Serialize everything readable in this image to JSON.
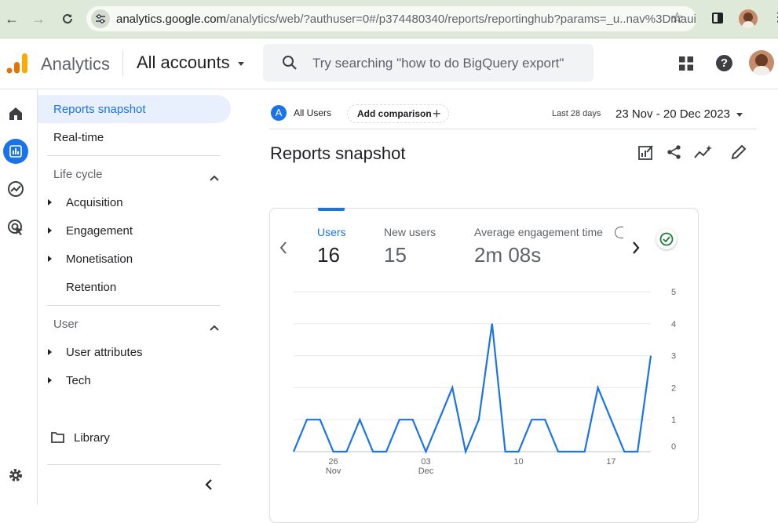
{
  "browser": {
    "url_host": "analytics.google.com",
    "url_rest": "/analytics/web/?authuser=0#/p374480340/reports/reportinghub?params=_u..nav%3Dmaui"
  },
  "header": {
    "brand": "Analytics",
    "accounts_label": "All accounts",
    "search_placeholder": "Try searching \"how to do BigQuery export\""
  },
  "sidenav": {
    "reports_snapshot": "Reports snapshot",
    "realtime": "Real-time",
    "lifecycle_title": "Life cycle",
    "lifecycle_items": [
      "Acquisition",
      "Engagement",
      "Monetisation",
      "Retention"
    ],
    "user_title": "User",
    "user_items": [
      "User attributes",
      "Tech"
    ],
    "library": "Library"
  },
  "toolbar": {
    "segment_avatar": "A",
    "segment_label": "All Users",
    "add_comparison": "Add comparison",
    "date_prefix": "Last 28 days",
    "date_range": "23 Nov - 20 Dec 2023"
  },
  "page": {
    "title": "Reports snapshot"
  },
  "metrics": [
    {
      "label": "Users",
      "value": "16",
      "active": true
    },
    {
      "label": "New users",
      "value": "15",
      "active": false
    },
    {
      "label": "Average engagement time",
      "value": "2m 08s",
      "active": false
    }
  ],
  "colors": {
    "accent": "#1a73e8",
    "line": "#1a73e8",
    "success": "#188038"
  },
  "chart_data": {
    "type": "line",
    "series": [
      {
        "values": [
          0,
          1,
          1,
          0,
          0,
          1,
          0,
          0,
          1,
          1,
          0,
          1,
          2,
          0,
          1,
          4,
          0,
          0,
          1,
          1,
          0,
          0,
          0,
          2,
          1,
          0,
          0,
          3
        ]
      }
    ],
    "x_ticks": [
      {
        "index": 3,
        "day": "26",
        "month": "Nov"
      },
      {
        "index": 10,
        "day": "03",
        "month": "Dec"
      },
      {
        "index": 17,
        "day": "10",
        "month": ""
      },
      {
        "index": 24,
        "day": "17",
        "month": ""
      }
    ],
    "y_ticks": [
      "0",
      "1",
      "2",
      "3",
      "4",
      "5"
    ],
    "ylim": [
      0,
      5
    ]
  }
}
